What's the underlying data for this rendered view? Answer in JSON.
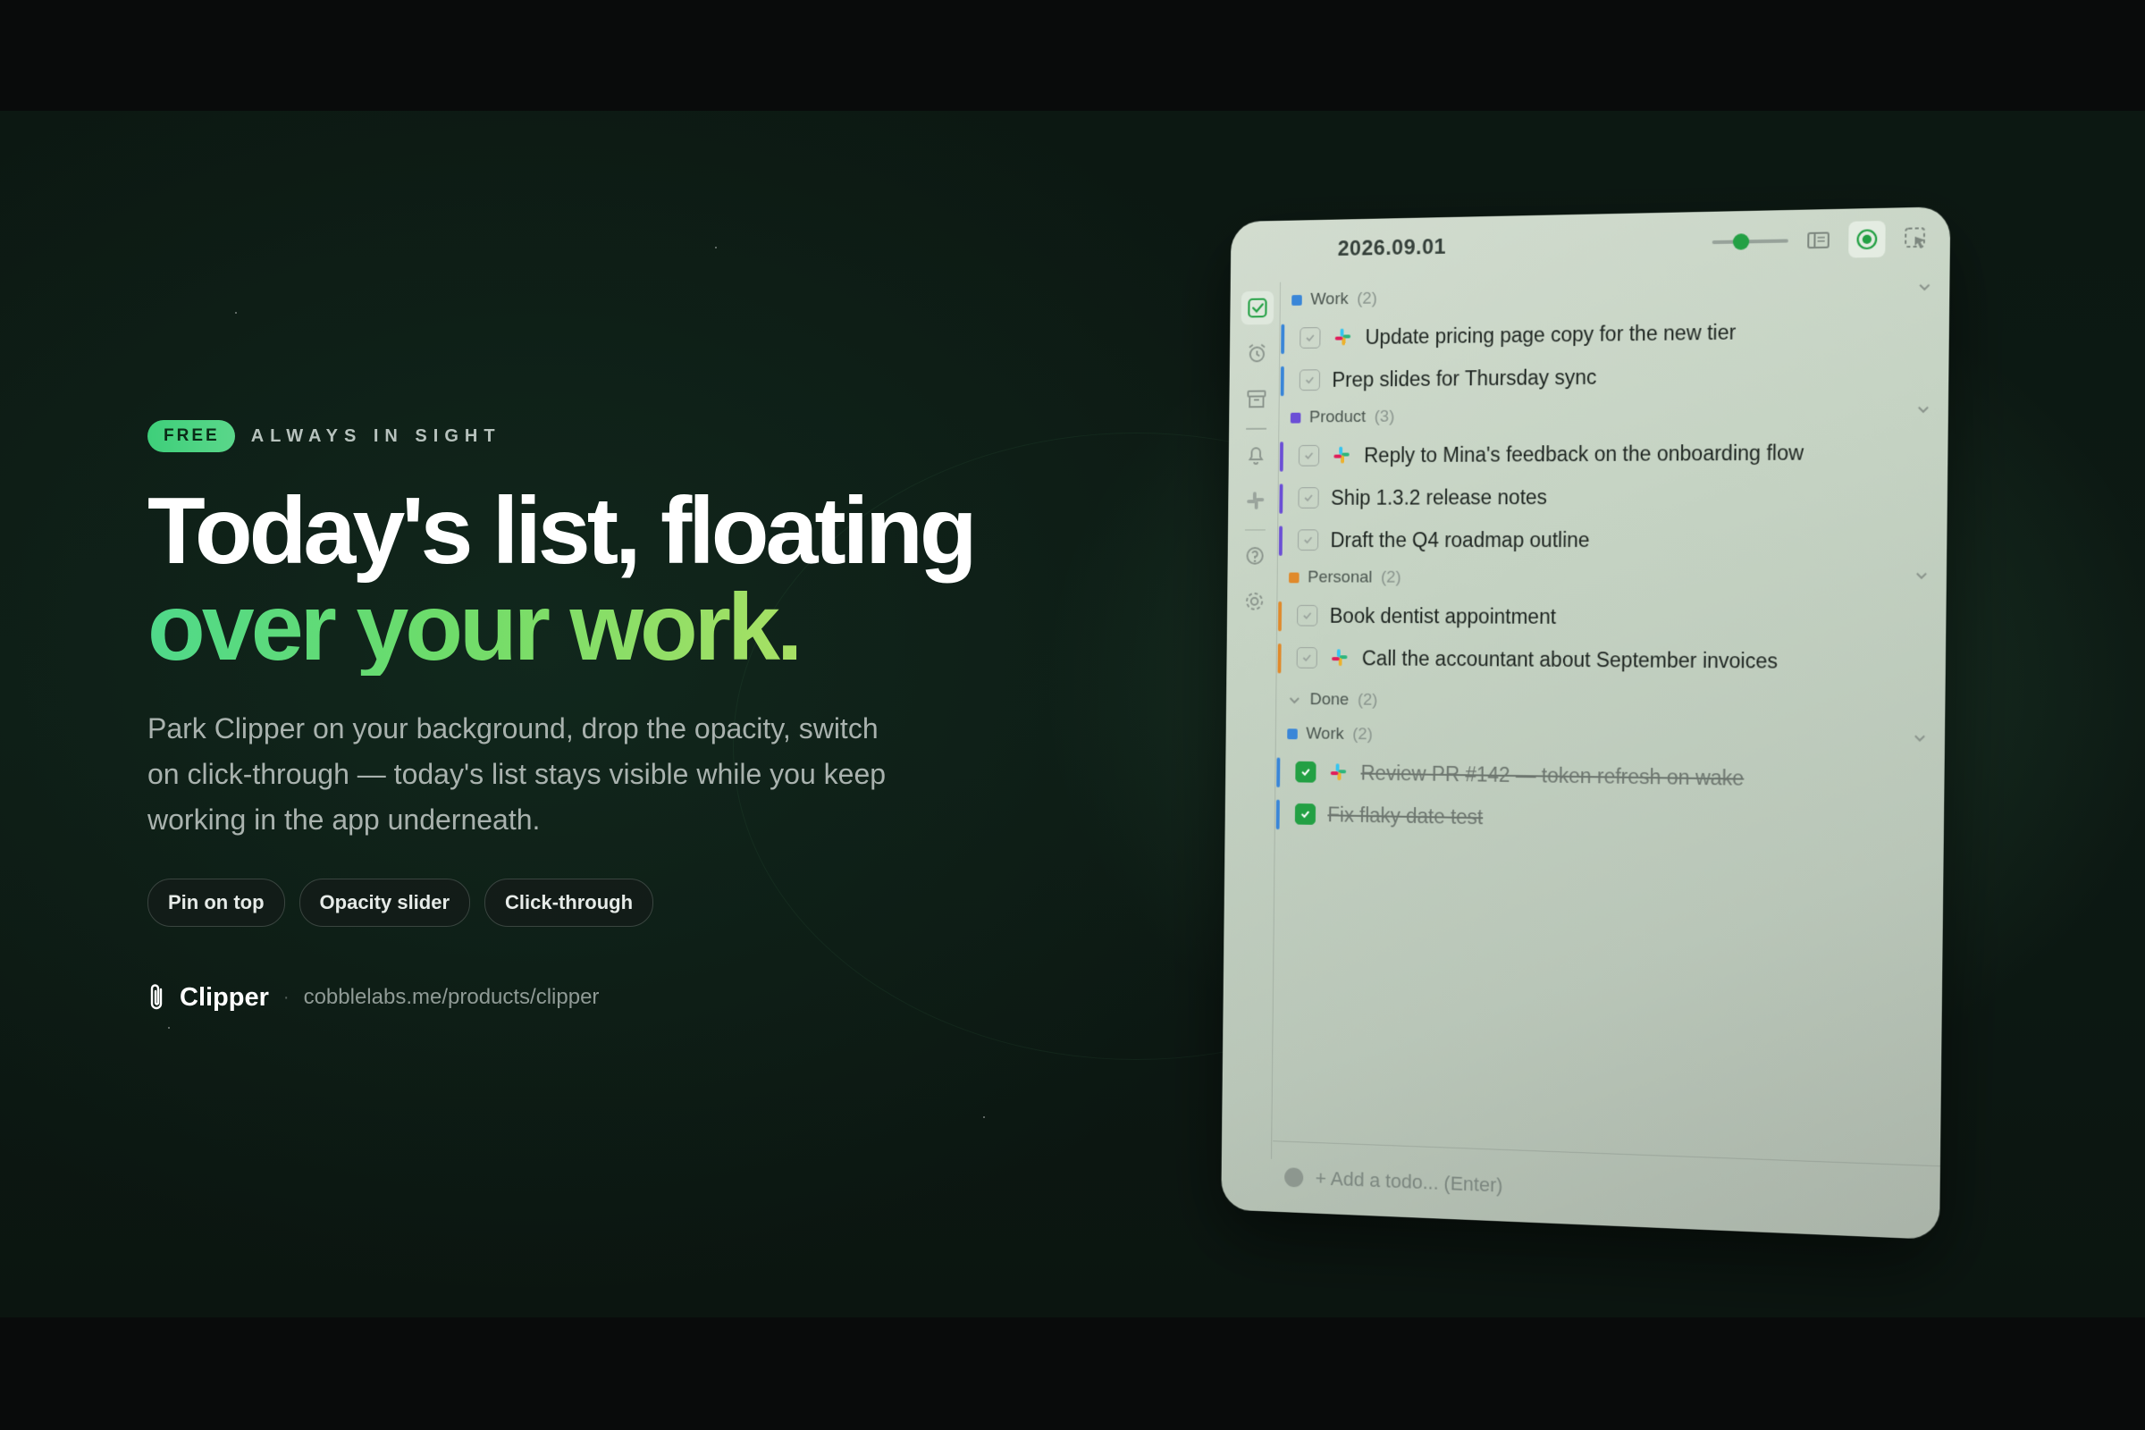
{
  "hero": {
    "badge": "FREE",
    "eyebrow": "ALWAYS IN SIGHT",
    "headline_line1": "Today's list, floating",
    "headline_line2": "over your work.",
    "subcopy": "Park Clipper on your background, drop the opacity, switch on click-through — today's list stays visible while you keep working in the app underneath.",
    "chips": [
      "Pin on top",
      "Opacity slider",
      "Click-through"
    ],
    "brand_name": "Clipper",
    "brand_separator": "·",
    "brand_url": "cobblelabs.me/products/clipper"
  },
  "colors": {
    "accent_green": "#3ecf7a",
    "work": "#3a86d8",
    "product": "#6b4fd6",
    "personal": "#e08a2c",
    "done_check": "#23a044"
  },
  "window": {
    "date": "2026.09.01",
    "opacity_level": 0.35,
    "toolbar_icons": [
      "opacity-slider",
      "sidebar-toggle-icon",
      "pin-on-top-icon",
      "click-through-icon"
    ],
    "sidebar_icons": [
      "checklist-icon",
      "alarm-clock-icon",
      "archive-icon",
      "bell-icon",
      "slack-icon",
      "help-icon",
      "gear-icon"
    ],
    "groups": [
      {
        "name": "Work",
        "count": "(2)",
        "color": "#3a86d8",
        "items": [
          {
            "text": "Update pricing page copy for the new tier",
            "slack": true
          },
          {
            "text": "Prep slides for Thursday sync",
            "slack": false
          }
        ]
      },
      {
        "name": "Product",
        "count": "(3)",
        "color": "#6b4fd6",
        "items": [
          {
            "text": "Reply to Mina's feedback on the onboarding flow",
            "slack": true
          },
          {
            "text": "Ship 1.3.2 release notes",
            "slack": false
          },
          {
            "text": "Draft the Q4 roadmap outline",
            "slack": false
          }
        ]
      },
      {
        "name": "Personal",
        "count": "(2)",
        "color": "#e08a2c",
        "items": [
          {
            "text": "Book dentist appointment",
            "slack": false
          },
          {
            "text": "Call the accountant about September invoices",
            "slack": true
          }
        ]
      }
    ],
    "done": {
      "label": "Done",
      "count": "(2)",
      "group": {
        "name": "Work",
        "count": "(2)",
        "color": "#3a86d8",
        "items": [
          {
            "text": "Review PR #142 — token refresh on wake",
            "slack": true
          },
          {
            "text": "Fix flaky date test",
            "slack": false
          }
        ]
      }
    },
    "add_placeholder": "+ Add a todo... (Enter)"
  }
}
